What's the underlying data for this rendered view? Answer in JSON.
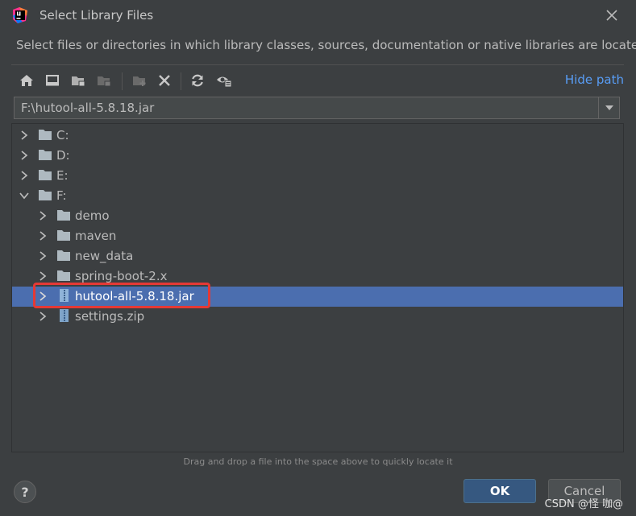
{
  "dialog": {
    "title": "Select Library Files",
    "description": "Select files or directories in which library classes, sources, documentation or native libraries are located"
  },
  "toolbar": {
    "hide_path_label": "Hide path",
    "icons": [
      "home-icon",
      "desktop-icon",
      "project-folder-icon",
      "module-folder-icon",
      "new-folder-icon",
      "delete-icon",
      "refresh-icon",
      "show-hidden-icon"
    ]
  },
  "path_field": {
    "value": "F:\\hutool-all-5.8.18.jar"
  },
  "tree": {
    "items": [
      {
        "label": "C:",
        "level": 0,
        "expanded": false,
        "type": "folder"
      },
      {
        "label": "D:",
        "level": 0,
        "expanded": false,
        "type": "folder"
      },
      {
        "label": "E:",
        "level": 0,
        "expanded": false,
        "type": "folder"
      },
      {
        "label": "F:",
        "level": 0,
        "expanded": true,
        "type": "folder"
      },
      {
        "label": "demo",
        "level": 1,
        "expanded": false,
        "type": "folder"
      },
      {
        "label": "maven",
        "level": 1,
        "expanded": false,
        "type": "folder"
      },
      {
        "label": "new_data",
        "level": 1,
        "expanded": false,
        "type": "folder"
      },
      {
        "label": "spring-boot-2.x",
        "level": 1,
        "expanded": false,
        "type": "folder"
      },
      {
        "label": "hutool-all-5.8.18.jar",
        "level": 1,
        "expanded": false,
        "type": "archive",
        "selected": true
      },
      {
        "label": "settings.zip",
        "level": 1,
        "expanded": false,
        "type": "archive"
      }
    ]
  },
  "hint": "Drag and drop a file into the space above to quickly locate it",
  "buttons": {
    "help": "?",
    "ok": "OK",
    "cancel": "Cancel"
  },
  "watermark": "CSDN @怪 咖@",
  "colors": {
    "background": "#3c3f41",
    "selection": "#4b6eaf",
    "link": "#589df6",
    "highlight_box": "#e53935",
    "ok_button": "#365880"
  }
}
